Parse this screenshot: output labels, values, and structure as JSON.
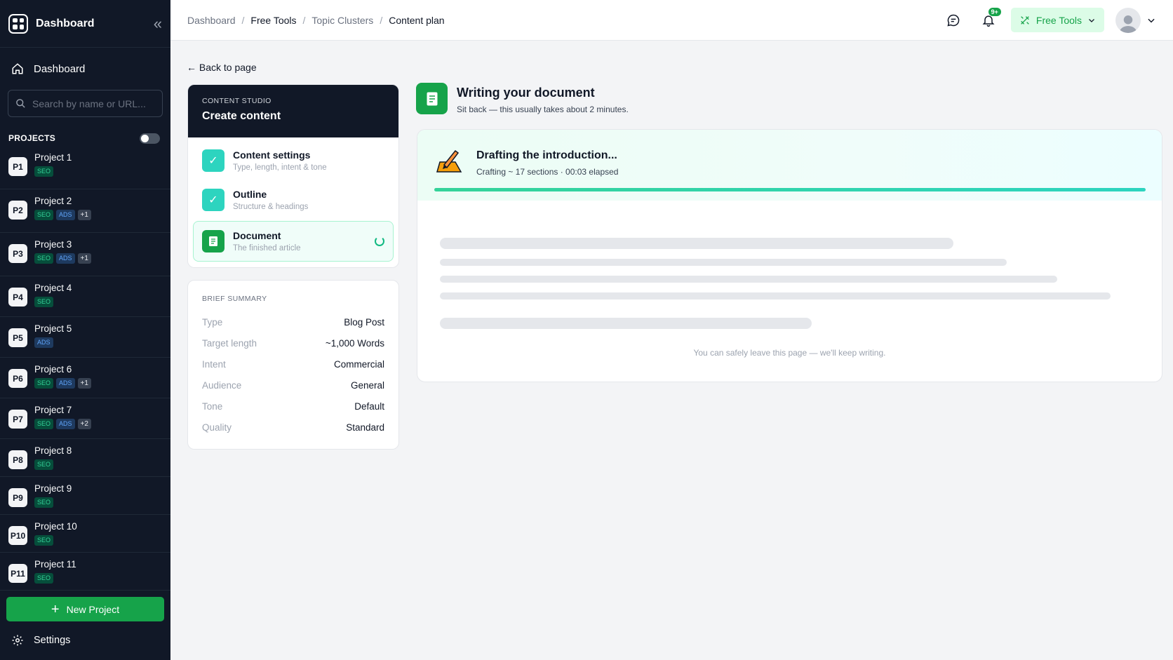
{
  "sidebar": {
    "title": "Dashboard",
    "nav_dashboard": "Dashboard",
    "search_placeholder": "Search by name or URL...",
    "projects_heading": "PROJECTS",
    "projects": [
      {
        "badge": "P1",
        "name": "Project 1",
        "tags": [
          "SEO"
        ]
      },
      {
        "badge": "P2",
        "name": "Project 2",
        "tags": [
          "SEO",
          "ADS",
          "+1"
        ]
      },
      {
        "badge": "P3",
        "name": "Project 3",
        "tags": [
          "SEO",
          "ADS",
          "+1"
        ]
      },
      {
        "badge": "P4",
        "name": "Project 4",
        "tags": [
          "SEO"
        ]
      },
      {
        "badge": "P5",
        "name": "Project 5",
        "tags": [
          "ADS"
        ]
      },
      {
        "badge": "P6",
        "name": "Project 6",
        "tags": [
          "SEO",
          "ADS",
          "+1"
        ]
      },
      {
        "badge": "P7",
        "name": "Project 7",
        "tags": [
          "SEO",
          "ADS",
          "+2"
        ]
      },
      {
        "badge": "P8",
        "name": "Project 8",
        "tags": [
          "SEO"
        ]
      },
      {
        "badge": "P9",
        "name": "Project 9",
        "tags": [
          "SEO"
        ]
      },
      {
        "badge": "P10",
        "name": "Project 10",
        "tags": [
          "SEO"
        ]
      },
      {
        "badge": "P11",
        "name": "Project 11",
        "tags": [
          "SEO"
        ]
      }
    ],
    "new_project_label": "New Project",
    "settings_label": "Settings"
  },
  "topbar": {
    "breadcrumbs": [
      "Dashboard",
      "Free Tools",
      "Topic Clusters",
      "Content plan"
    ],
    "notification_badge": "9+",
    "free_tools_label": "Free Tools"
  },
  "main": {
    "back_label": "← Back to page",
    "studio": {
      "eyebrow": "CONTENT STUDIO",
      "title": "Create content",
      "steps": [
        {
          "title": "Content settings",
          "subtitle": "Type, length, intent & tone",
          "status": "done"
        },
        {
          "title": "Outline",
          "subtitle": "Structure & headings",
          "status": "done"
        },
        {
          "title": "Document",
          "subtitle": "The finished article",
          "status": "in-progress"
        }
      ]
    },
    "brief": {
      "eyebrow": "BRIEF SUMMARY",
      "rows": [
        {
          "key": "Type",
          "value": "Blog Post"
        },
        {
          "key": "Target length",
          "value": "~1,000 Words"
        },
        {
          "key": "Intent",
          "value": "Commercial"
        },
        {
          "key": "Audience",
          "value": "General"
        },
        {
          "key": "Tone",
          "value": "Default"
        },
        {
          "key": "Quality",
          "value": "Standard"
        }
      ]
    },
    "writing": {
      "title": "Writing your document",
      "subtitle": "Sit back — this usually takes about 2 minutes."
    },
    "progress": {
      "emoji": "✍",
      "title": "Drafting the introduction...",
      "status": "Crafting ~ 17 sections · 00:03 elapsed",
      "progress_fraction": 1.0,
      "footer": "You can safely leave this page — we'll keep writing."
    }
  },
  "colors": {
    "sidebar_bg": "#111827",
    "accent_green": "#16a34a",
    "teal_check": "#2dd4bf"
  }
}
